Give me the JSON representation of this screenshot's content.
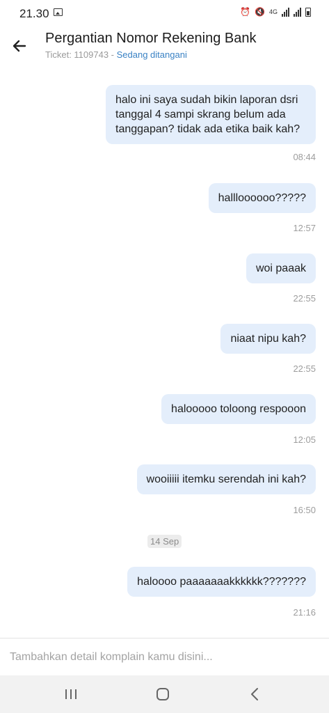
{
  "status_bar": {
    "time": "21.30",
    "network": "4G"
  },
  "header": {
    "title": "Pergantian Nomor Rekening Bank",
    "ticket_label": "Ticket: 1109743 - ",
    "status": "Sedang ditangani"
  },
  "messages": [
    {
      "text": "halo ini saya sudah bikin laporan dsri tanggal 4 sampi skrang belum ada tanggapan? tidak ada etika baik kah?",
      "time": "08:44"
    },
    {
      "text": "hallloooooo?????",
      "time": "12:57"
    },
    {
      "text": "woi paaak",
      "time": "22:55"
    },
    {
      "text": "niaat nipu kah?",
      "time": "22:55"
    },
    {
      "text": "halooooo toloong respooon",
      "time": "12:05"
    },
    {
      "text": "wooiiiii itemku serendah ini kah?",
      "time": "16:50"
    },
    {
      "text": "haloooo paaaaaaakkkkkk???????",
      "time": "21:16"
    }
  ],
  "date_separator": "14 Sep",
  "composer": {
    "placeholder": "Tambahkan detail komplain kamu disini..."
  },
  "colors": {
    "bubble": "#e4eefb",
    "status_link": "#3a82c4",
    "nav_bar": "#f2f2f2"
  },
  "icons": [
    "image-icon",
    "alarm-icon",
    "mute-icon",
    "signal-icon",
    "battery-icon",
    "back-arrow-icon",
    "recents-icon",
    "home-icon",
    "back-nav-icon"
  ]
}
